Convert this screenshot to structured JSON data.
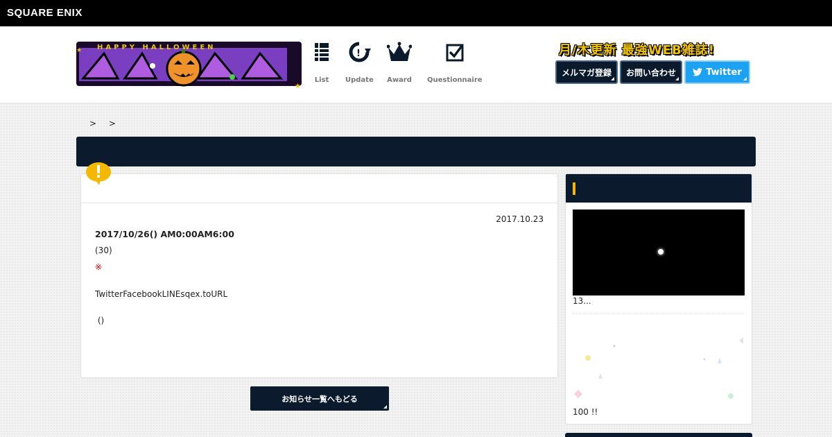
{
  "corporate": {
    "logo_text": "SQUARE ENIX"
  },
  "header": {
    "tagline": "月/木更新 最強WEB雑誌!",
    "nav": [
      {
        "label": "List",
        "icon": "list-icon"
      },
      {
        "label": "Update",
        "icon": "update-icon"
      },
      {
        "label": "Award",
        "icon": "crown-icon"
      },
      {
        "label": "Questionnaire",
        "icon": "checkbox-icon"
      }
    ],
    "buttons": {
      "mailmag": "メルマガ登録",
      "contact": "お問い合わせ",
      "twitter": "Twitter"
    }
  },
  "breadcrumb": {
    "sep1": ">",
    "sep2": ">"
  },
  "article": {
    "date": "2017.10.23",
    "line1": "2017/10/26() AM0:00AM6:00",
    "line2": "(30)",
    "note_mark": "※",
    "line3": "TwitterFacebookLINEsqex.toURL",
    "line4": " ()"
  },
  "back_button": "お知らせ一覧へもどる",
  "sidebar": {
    "caption1": "13...",
    "caption2": "100 !!"
  },
  "colors": {
    "navy": "#0b1a2d",
    "twitter": "#1da1f2",
    "accent_yellow": "#f5b800"
  }
}
